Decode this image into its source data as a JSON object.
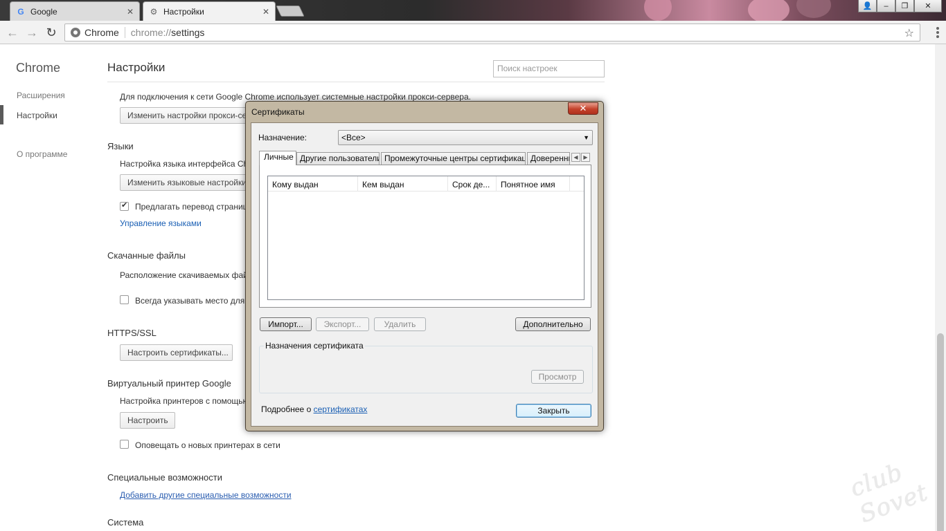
{
  "browser": {
    "tabs": [
      {
        "title": "Google",
        "icon": "google-icon",
        "close": "✕"
      },
      {
        "title": "Настройки",
        "icon": "gear-icon",
        "close": "✕"
      }
    ],
    "omnibox": {
      "site_label": "Chrome",
      "url_scheme": "chrome://",
      "url_path": "settings"
    },
    "window_buttons": {
      "user": "👤",
      "minimize": "–",
      "restore": "❐",
      "close": "✕"
    }
  },
  "nav": {
    "title": "Chrome",
    "items": [
      {
        "label": "Расширения"
      },
      {
        "label": "Настройки"
      },
      {
        "label": "О программе"
      }
    ]
  },
  "settings": {
    "title": "Настройки",
    "search_placeholder": "Поиск настроек",
    "proxy": {
      "text": "Для подключения к сети Google Chrome использует системные настройки прокси-сервера.",
      "button": "Изменить настройки прокси-сервера..."
    },
    "languages": {
      "header": "Языки",
      "text": "Настройка языка интерфейса Chrome",
      "button": "Изменить языковые настройки...",
      "translate_label": "Предлагать перевод страниц",
      "manage_link": "Управление языками"
    },
    "downloads": {
      "header": "Скачанные файлы",
      "text": "Расположение скачиваемых файлов",
      "ask_label": "Всегда указывать место для скачивания"
    },
    "https": {
      "header": "HTTPS/SSL",
      "button": "Настроить сертификаты..."
    },
    "cloud_print": {
      "header": "Виртуальный принтер Google",
      "text": "Настройка принтеров с помощью виртуального принтера Google",
      "button": "Настроить",
      "notify_label": "Оповещать о новых принтерах в сети"
    },
    "accessibility": {
      "header": "Специальные возможности",
      "link": "Добавить другие специальные возможности"
    },
    "system": {
      "header": "Система"
    }
  },
  "dialog": {
    "title": "Сертификаты",
    "close": "✕",
    "purpose_label": "Назначение:",
    "purpose_value": "<Все>",
    "tabs": [
      "Личные",
      "Другие пользователи",
      "Промежуточные центры сертификации",
      "Доверенные"
    ],
    "columns": [
      "Кому выдан",
      "Кем выдан",
      "Срок де...",
      "Понятное имя"
    ],
    "buttons": {
      "import": "Импорт...",
      "export": "Экспорт...",
      "remove": "Удалить",
      "advanced": "Дополнительно",
      "view": "Просмотр",
      "close": "Закрыть"
    },
    "group_label": "Назначения сертификата",
    "footer_text": "Подробнее о ",
    "footer_link": "сертификатах"
  },
  "watermark": "club Sovet"
}
